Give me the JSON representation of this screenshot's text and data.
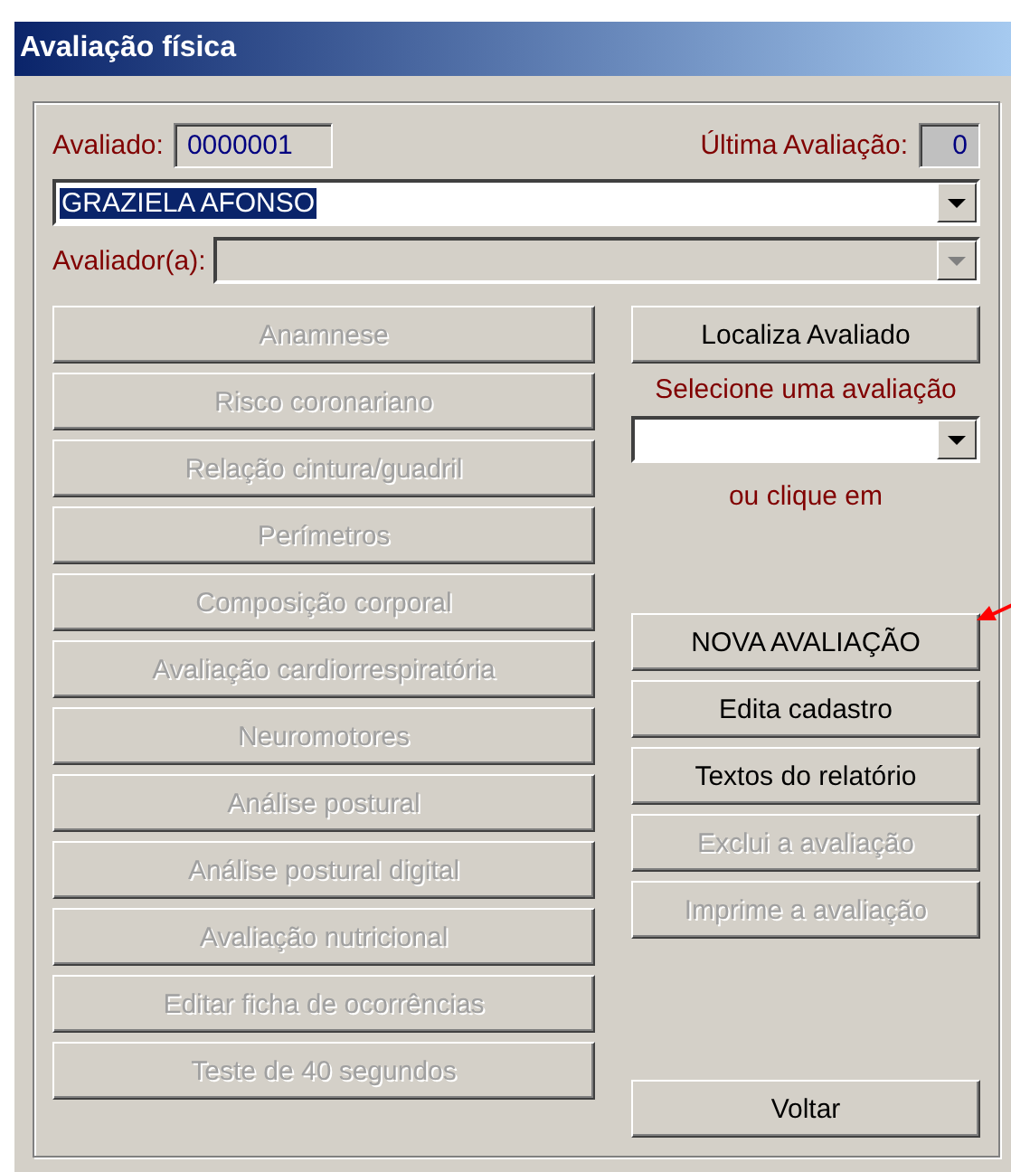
{
  "window": {
    "title": "Avaliação física"
  },
  "avaliado": {
    "label": "Avaliado:",
    "value": "0000001"
  },
  "ultima": {
    "label": "Última Avaliação:",
    "value": "0"
  },
  "name_combo": {
    "value": "GRAZIELA AFONSO",
    "selected": true,
    "disabled": false
  },
  "avaliador": {
    "label": "Avaliador(a):",
    "disabled": true
  },
  "left_buttons": [
    {
      "label": "Anamnese",
      "disabled": true
    },
    {
      "label": "Risco coronariano",
      "disabled": true
    },
    {
      "label": "Relação cintura/guadril",
      "disabled": true
    },
    {
      "label": "Perímetros",
      "disabled": true
    },
    {
      "label": "Composição corporal",
      "disabled": true
    },
    {
      "label": "Avaliação cardiorrespiratória",
      "disabled": true
    },
    {
      "label": "Neuromotores",
      "disabled": true
    },
    {
      "label": "Análise postural",
      "disabled": true
    },
    {
      "label": "Análise postural digital",
      "disabled": true
    },
    {
      "label": "Avaliação nutricional",
      "disabled": true
    },
    {
      "label": "Editar ficha de ocorrências",
      "disabled": true
    },
    {
      "label": "Teste de 40 segundos",
      "disabled": true
    }
  ],
  "locate_button": {
    "label": "Localiza Avaliado",
    "disabled": false
  },
  "select_label": "Selecione uma avaliação",
  "or_label": "ou clique em",
  "right_buttons": [
    {
      "label": "NOVA AVALIAÇÃO",
      "disabled": false,
      "highlighted": true
    },
    {
      "label": "Edita cadastro",
      "disabled": false,
      "highlighted": false
    },
    {
      "label": "Textos do relatório",
      "disabled": false,
      "highlighted": false
    },
    {
      "label": "Exclui a avaliação",
      "disabled": true,
      "highlighted": false
    },
    {
      "label": "Imprime a avaliação",
      "disabled": true,
      "highlighted": false
    }
  ],
  "back_button": {
    "label": "Voltar",
    "disabled": false
  }
}
